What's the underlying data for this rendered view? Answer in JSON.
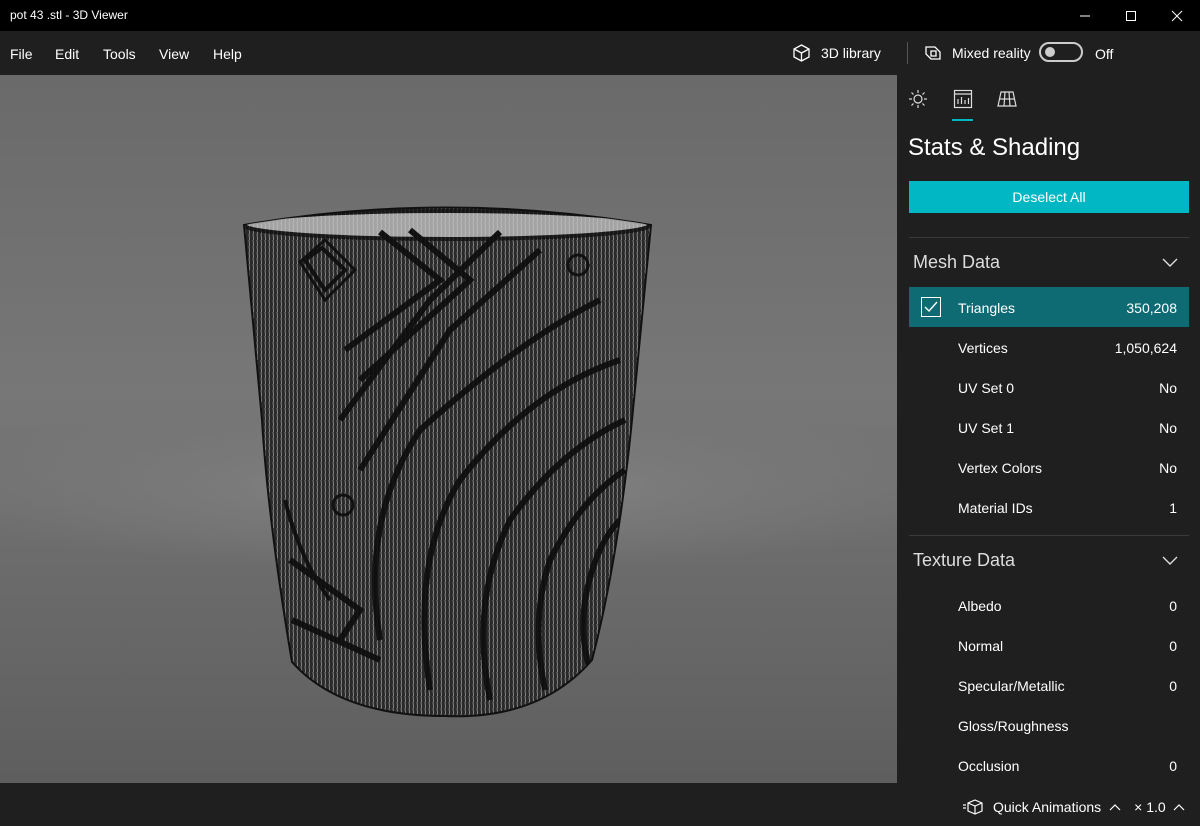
{
  "window": {
    "title": "pot 43 .stl - 3D Viewer"
  },
  "menu": {
    "items": [
      "File",
      "Edit",
      "Tools",
      "View",
      "Help"
    ]
  },
  "toolbar": {
    "library_label": "3D library",
    "mixed_reality_label": "Mixed reality",
    "toggle_state": "Off"
  },
  "panel": {
    "title": "Stats & Shading",
    "deselect_label": "Deselect All",
    "mesh_section": "Mesh Data",
    "mesh_rows": [
      {
        "label": "Triangles",
        "value": "350,208",
        "checked": true
      },
      {
        "label": "Vertices",
        "value": "1,050,624"
      },
      {
        "label": "UV Set 0",
        "value": "No"
      },
      {
        "label": "UV Set 1",
        "value": "No"
      },
      {
        "label": "Vertex Colors",
        "value": "No"
      },
      {
        "label": "Material IDs",
        "value": "1"
      }
    ],
    "texture_section": "Texture Data",
    "texture_rows": [
      {
        "label": "Albedo",
        "value": "0"
      },
      {
        "label": "Normal",
        "value": "0"
      },
      {
        "label": "Specular/Metallic",
        "value": "0"
      },
      {
        "label": "Gloss/Roughness",
        "value": ""
      },
      {
        "label": "Occlusion",
        "value": "0"
      }
    ]
  },
  "bottom": {
    "quick_animations": "Quick Animations",
    "speed": "× 1.0"
  },
  "colors": {
    "accent": "#00b7c3",
    "selected_row": "#0e6b74",
    "panel_bg": "#1f1f1f"
  }
}
